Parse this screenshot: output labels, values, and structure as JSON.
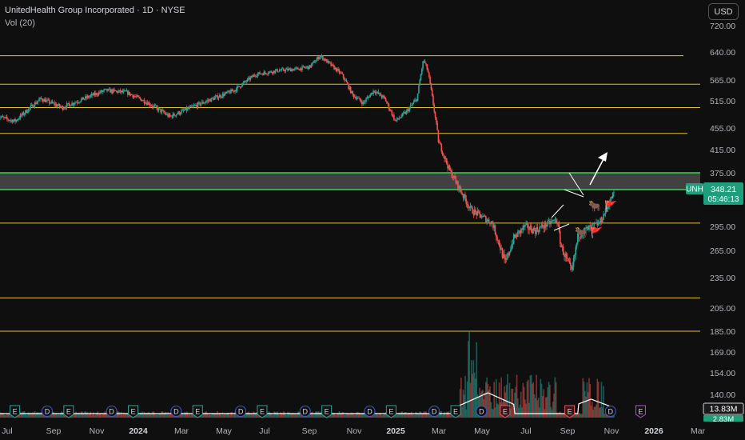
{
  "header": {
    "title": "UnitedHealth Group Incorporated · 1D · NYSE",
    "indicator": "Vol (20)",
    "currency": "USD"
  },
  "colors": {
    "background": "#0f0f0f",
    "up": "#26a69a",
    "down": "#ef5350",
    "level_line": "#e6c229",
    "zone_line": "#3fcf5f",
    "zone_fill": "#6b6b6b",
    "volume_ma": "#ffffff",
    "price_tag": "#1e9e7a",
    "earnings": "#26a69a",
    "dividend": "#3f57c9"
  },
  "chart_data": {
    "type": "candlestick",
    "symbol": "UNH",
    "last_price": "348.21",
    "countdown": "05:46:13",
    "volume_label": "13.83M",
    "volume_label2": "2.83M",
    "x_ticks": [
      "Jul",
      "Sep",
      "Nov",
      "2024",
      "Mar",
      "May",
      "Jul",
      "Sep",
      "Nov",
      "2025",
      "Mar",
      "May",
      "Jul",
      "Sep",
      "Nov",
      "2026",
      "Mar"
    ],
    "y_ticks": [
      "720.00",
      "640.00",
      "565.00",
      "515.00",
      "455.00",
      "415.00",
      "375.00",
      "295.00",
      "265.00",
      "235.00",
      "205.00",
      "185.00",
      "169.00",
      "154.00",
      "140.00"
    ],
    "horizontal_levels": [
      630,
      555,
      500,
      445,
      300,
      215,
      185
    ],
    "zone": [
      375,
      350
    ],
    "price_path_months": [
      -1.0,
      -0.2,
      1.0,
      2.0,
      3.0,
      4.0,
      5.0,
      6.0,
      7.0,
      8.0,
      9.0,
      10.0,
      11.0,
      12.0,
      13.0,
      13.5,
      14.0,
      15.0,
      15.5,
      16.0,
      16.5,
      17.0,
      17.5,
      18.0,
      18.5,
      18.8,
      19.0,
      19.5,
      20.0,
      21.0,
      22.0,
      22.6,
      23.0,
      23.5,
      24.0,
      25.0,
      25.2,
      25.7,
      26.0,
      27.0,
      27.7
    ],
    "price_path_values": [
      480,
      470,
      520,
      500,
      520,
      540,
      535,
      510,
      480,
      500,
      520,
      540,
      580,
      590,
      595,
      600,
      630,
      580,
      530,
      510,
      540,
      520,
      470,
      490,
      520,
      620,
      590,
      430,
      380,
      320,
      300,
      250,
      280,
      295,
      290,
      305,
      270,
      240,
      285,
      300,
      348
    ],
    "event_markers": [
      {
        "label": "E",
        "kind": "earnings",
        "month": -0.2
      },
      {
        "label": "D",
        "kind": "dividend",
        "month": 1.3
      },
      {
        "label": "E",
        "kind": "earnings",
        "month": 2.3
      },
      {
        "label": "D",
        "kind": "dividend",
        "month": 4.3
      },
      {
        "label": "E",
        "kind": "earnings",
        "month": 5.3
      },
      {
        "label": "D",
        "kind": "dividend",
        "month": 7.3
      },
      {
        "label": "E",
        "kind": "earnings",
        "month": 8.3
      },
      {
        "label": "D",
        "kind": "dividend",
        "month": 10.3
      },
      {
        "label": "E",
        "kind": "earnings",
        "month": 11.3
      },
      {
        "label": "D",
        "kind": "dividend",
        "month": 13.3
      },
      {
        "label": "E",
        "kind": "earnings",
        "month": 14.3
      },
      {
        "label": "D",
        "kind": "dividend",
        "month": 16.3
      },
      {
        "label": "E",
        "kind": "earnings",
        "month": 17.3
      },
      {
        "label": "D",
        "kind": "dividend",
        "month": 19.3
      },
      {
        "label": "E",
        "kind": "earnings",
        "month": 20.3
      },
      {
        "label": "D",
        "kind": "dividend",
        "month": 21.5
      },
      {
        "label": "E",
        "kind": "earnings_down",
        "month": 22.6
      },
      {
        "label": "E",
        "kind": "earnings_down",
        "month": 25.6
      },
      {
        "label": "D",
        "kind": "dividend",
        "month": 27.5
      },
      {
        "label": "E",
        "kind": "earnings_future",
        "month": 28.9
      }
    ]
  }
}
